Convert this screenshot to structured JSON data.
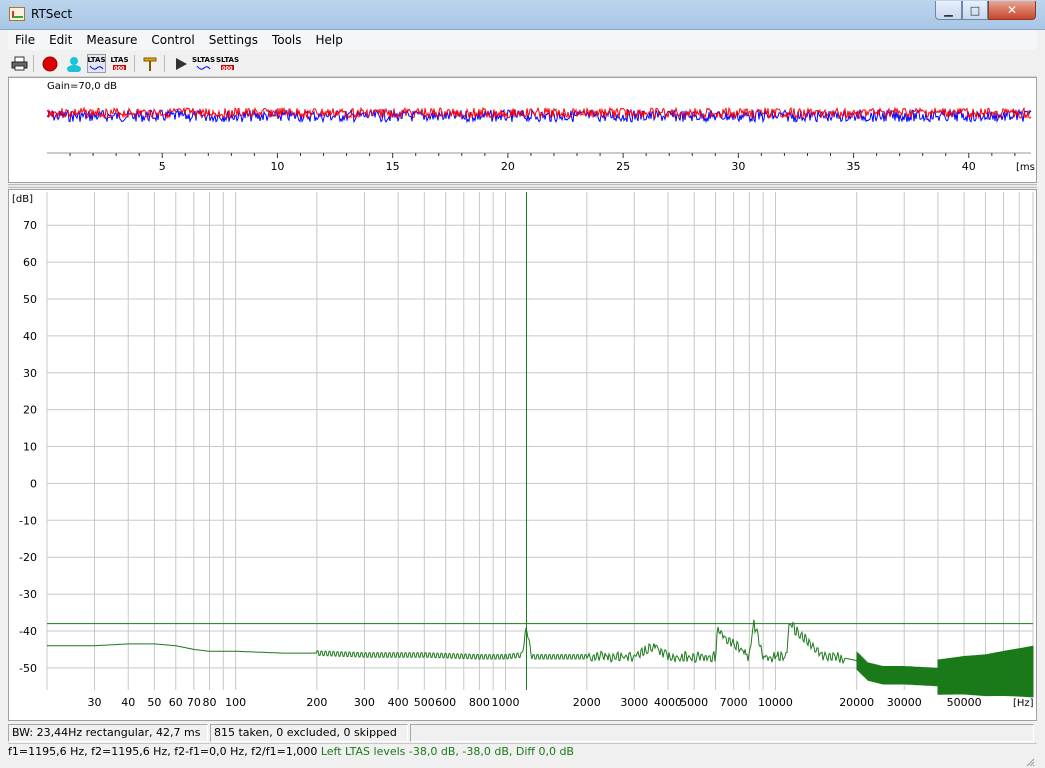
{
  "window": {
    "title": "RTSect",
    "minimize": "▁",
    "maximize": "□",
    "close": "✕"
  },
  "menu": {
    "items": [
      "File",
      "Edit",
      "Measure",
      "Control",
      "Settings",
      "Tools",
      "Help"
    ]
  },
  "toolbar": {
    "buttons": [
      {
        "name": "print",
        "icon": "printer-icon"
      },
      {
        "name": "record",
        "icon": "record-icon"
      },
      {
        "name": "user",
        "icon": "user-icon"
      },
      {
        "name": "ltas-view",
        "icon": "ltas-curve-icon",
        "label": "LTAS"
      },
      {
        "name": "ltas-levels",
        "icon": "ltas-levels-icon",
        "label": "LTAS"
      },
      {
        "name": "marker",
        "icon": "marker-icon"
      },
      {
        "name": "play",
        "icon": "play-icon"
      },
      {
        "name": "sltas-view",
        "icon": "sltas-curve-icon",
        "label": "SLTAS"
      },
      {
        "name": "sltas-levels",
        "icon": "sltas-levels-icon",
        "label": "SLTAS"
      }
    ]
  },
  "waveform": {
    "gain_label": "Gain=70,0 dB",
    "x_unit": "[ms]",
    "x_ticks": [
      5,
      10,
      15,
      20,
      25,
      30,
      35,
      40
    ],
    "x_range": [
      0,
      42.7
    ],
    "colors": {
      "channel_a": "#ff0000",
      "channel_b": "#0000ff"
    }
  },
  "chart_data": {
    "type": "line",
    "title": "",
    "xlabel": "[Hz]",
    "ylabel": "[dB]",
    "x_scale": "log",
    "xlim": [
      20,
      90000
    ],
    "ylim": [
      -56,
      79
    ],
    "y_ticks": [
      70,
      60,
      50,
      40,
      30,
      20,
      10,
      0,
      -10,
      -20,
      -30,
      -40,
      -50
    ],
    "x_tick_labels": [
      {
        "value": 30,
        "label": "30"
      },
      {
        "value": 40,
        "label": "40"
      },
      {
        "value": 50,
        "label": "50"
      },
      {
        "value": 60,
        "label": "60"
      },
      {
        "value": 70,
        "label": "70"
      },
      {
        "value": 80,
        "label": "80"
      },
      {
        "value": 100,
        "label": "100"
      },
      {
        "value": 200,
        "label": "200"
      },
      {
        "value": 300,
        "label": "300"
      },
      {
        "value": 400,
        "label": "400"
      },
      {
        "value": 500,
        "label": "500"
      },
      {
        "value": 600,
        "label": "600"
      },
      {
        "value": 800,
        "label": "800"
      },
      {
        "value": 1000,
        "label": "1000"
      },
      {
        "value": 2000,
        "label": "2000"
      },
      {
        "value": 3000,
        "label": "3000"
      },
      {
        "value": 4000,
        "label": "4000"
      },
      {
        "value": 5000,
        "label": "5000"
      },
      {
        "value": 7000,
        "label": "7000"
      },
      {
        "value": 10000,
        "label": "10000"
      },
      {
        "value": 20000,
        "label": "20000"
      },
      {
        "value": 30000,
        "label": "30000"
      },
      {
        "value": 50000,
        "label": "50000"
      }
    ],
    "grid": true,
    "color": "#1a7a1a",
    "reference_level": -38,
    "cursor_freq": 1195.6,
    "series": [
      {
        "x": [
          20,
          30,
          40,
          50,
          60,
          70,
          80,
          100,
          150,
          200,
          300,
          500,
          800,
          1000,
          1150,
          1195.6,
          1250,
          1500,
          2000,
          3000,
          3600,
          4000,
          6000,
          6100,
          8000,
          8300,
          9000,
          11000,
          11200,
          15000,
          17000,
          20000,
          22000,
          25000,
          30000,
          40000,
          50000,
          60000,
          70000,
          90000
        ],
        "y": [
          -44,
          -44,
          -43.5,
          -43.5,
          -44,
          -45,
          -45.5,
          -45.5,
          -46,
          -46,
          -46.5,
          -46.5,
          -47,
          -47,
          -46.5,
          -39,
          -47,
          -47,
          -47,
          -47,
          -44,
          -47,
          -47,
          -40,
          -47,
          -37.5,
          -47,
          -47,
          -38,
          -47,
          -47,
          -48,
          -51,
          -52,
          -52,
          -52.5,
          -52,
          -52,
          -51.5,
          -51
        ]
      }
    ]
  },
  "status": {
    "bandwidth": "BW: 23,44Hz rectangular, 42,7 ms",
    "counts": "815 taken, 0 excluded, 0 skipped",
    "extra": "",
    "freqs": "f1=1195,6 Hz, f2=1195,6 Hz, f2-f1=0,0 Hz, f2/f1=1,000",
    "ltas": "Left LTAS levels -38,0 dB, -38,0 dB, Diff 0,0 dB"
  }
}
